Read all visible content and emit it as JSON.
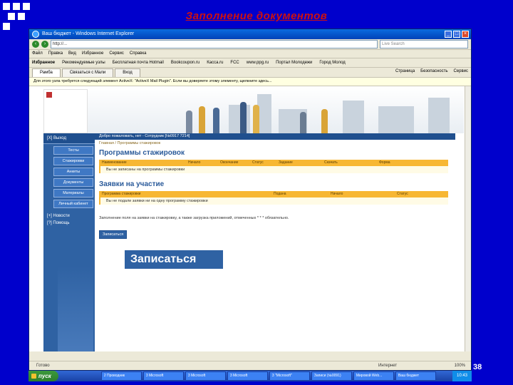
{
  "slide": {
    "title": "Заполнение документов",
    "page_number": "38"
  },
  "browser": {
    "title": "Ваш бюджет - Windows Internet Explorer",
    "url": "http://...",
    "search_placeholder": "Live Search",
    "menu": [
      "Файл",
      "Правка",
      "Вид",
      "Избранное",
      "Сервис",
      "Справка"
    ],
    "favorites": [
      "Избранное",
      "Рекомендуемые узлы",
      "Бесплатная почта Hotmail",
      "Bookcoupon.ru",
      "Касса.ru",
      "FCC",
      "www.ppg.ru",
      "Портал Молодежи",
      "Город Молод"
    ],
    "tabs": [
      "Рамба",
      "Связаться с Мали",
      "Вход"
    ],
    "toolbar_right": [
      "Страница",
      "Безопасность",
      "Сервис"
    ],
    "infobar": "Для этого узла требуется следующий элемент ActiveX: \"ActiveX Mail Plugin\". Если вы доверяете этому элементу, щелкните здесь..."
  },
  "site": {
    "logo_text": "",
    "user_bar": "Добро пожаловать, нет - Сотрудник [№0917 7214]",
    "breadcrumb": "Главная / Программы стажировок",
    "sidebar": {
      "top_label": "[Х] Выход",
      "buttons": [
        "Тесты",
        "Стажировки",
        "Анкеты",
        "Документы",
        "Материалы",
        "Личный кабинет"
      ],
      "links": [
        "[+] Новости",
        "[?] Помощь"
      ]
    },
    "programs": {
      "heading": "Программы стажировок",
      "columns": [
        "Наименование",
        "Начало",
        "Окончание",
        "Статус",
        "Задание",
        "Скачать",
        "Форма"
      ],
      "empty_note": "Вы не записаны на программы стажировки"
    },
    "applications": {
      "heading": "Заявки на участие",
      "columns": [
        "Программа стажировки",
        "Подана",
        "Начало",
        "Статус"
      ],
      "empty_note": "Вы не подали заявки ни на одну программу стажировки"
    },
    "requirement_note": "Заполнение поля на заявки на стажировку, а также загрузка приложений, отмеченных * * * обязательно.",
    "submit_button": "Записаться"
  },
  "statusbar": {
    "left": "Готово",
    "zone": "Интернет",
    "zoom": "100%"
  },
  "callout": {
    "label": "Записаться"
  },
  "taskbar": {
    "start": "пуск",
    "items": [
      "2 Проводник",
      "3 Microsoft",
      "3 Microsoft",
      "3 Microsoft",
      "3 \"Microsoft\"",
      "Записи (№0091)",
      "Мировой Web...",
      "Ваш бюджет"
    ],
    "clock": "10:43"
  }
}
